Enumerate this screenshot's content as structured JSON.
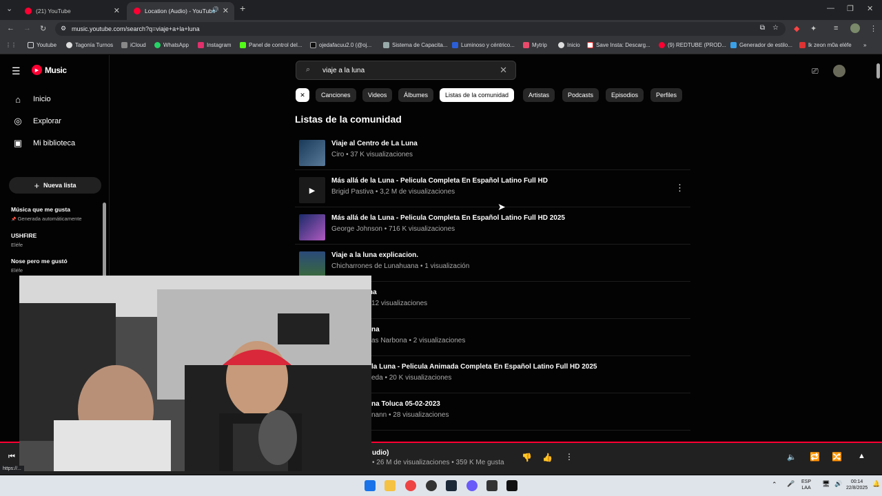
{
  "browser": {
    "tabs": [
      {
        "label": "(21) YouTube"
      },
      {
        "label": "Location (Audio) - YouTube"
      }
    ],
    "url": "music.youtube.com/search?q=viaje+a+la+luna",
    "bookmarks": [
      "Youtube",
      "Tagonía Turnos",
      "iCloud",
      "WhatsApp",
      "Instagram",
      "Panel de control del...",
      "ojedafacuu2.0 (@oj...",
      "Sistema de Capacita...",
      "Luminoso y céntrico...",
      "Mytrip",
      "Inicio",
      "Save Insta: Descarg...",
      "(9) REDTUBE (PROD...",
      "Generador de estilo...",
      "lk zeon m0a eléfe"
    ],
    "status_url": "https://..."
  },
  "app": {
    "logo": "Music",
    "nav": [
      {
        "label": "Inicio",
        "icon": "home-icon"
      },
      {
        "label": "Explorar",
        "icon": "compass-icon"
      },
      {
        "label": "Mi biblioteca",
        "icon": "library-icon"
      }
    ],
    "new_list": "Nueva lista",
    "playlists": [
      {
        "title": "Música que me gusta",
        "sub": "Generada automáticamente"
      },
      {
        "title": "USHFIRE",
        "sub": "Eléfe"
      },
      {
        "title": "Nose pero me gustó",
        "sub": "Eléfe"
      }
    ],
    "search": {
      "query": "viaje a la luna"
    },
    "chips": [
      "Canciones",
      "Videos",
      "Álbumes",
      "Listas de la comunidad",
      "Artistas",
      "Podcasts",
      "Episodios",
      "Perfiles"
    ],
    "section_title": "Listas de la comunidad",
    "results": [
      {
        "title": "Viaje al Centro de La Luna",
        "sub": "Ciro • 37 K visualizaciones"
      },
      {
        "title": "Más allá de la Luna - Pelicula Completa En Español Latino Full HD",
        "sub": "Brigid Pastiva • 3,2 M de visualizaciones"
      },
      {
        "title": "Más allá de la Luna - Pelicula Completa En Español Latino Full HD 2025",
        "sub": "George Johnson • 716 K visualizaciones"
      },
      {
        "title": "Viaje a la luna explicacion.",
        "sub": "Chicharrones de Lunahuana • 1 visualización"
      },
      {
        "title": "na",
        "sub": "12 visualizaciones"
      },
      {
        "title": "na",
        "sub": "as Narbona • 2 visualizaciones"
      },
      {
        "title": "la Luna - Pelicula Animada Completa En Español Latino Full HD 2025",
        "sub": "eda • 20 K visualizaciones"
      },
      {
        "title": "na Toluca 05-02-2023",
        "sub": "nann • 28 visualizaciones"
      }
    ],
    "player": {
      "title": "udio)",
      "meta": "• 26 M de visualizaciones • 359 K Me gusta"
    }
  },
  "taskbar": {
    "lang": "ESP",
    "region": "LAA",
    "time": "00:14",
    "date": "22/8/2025"
  },
  "colors": {
    "accent": "#ff0033",
    "background": "#030303"
  }
}
